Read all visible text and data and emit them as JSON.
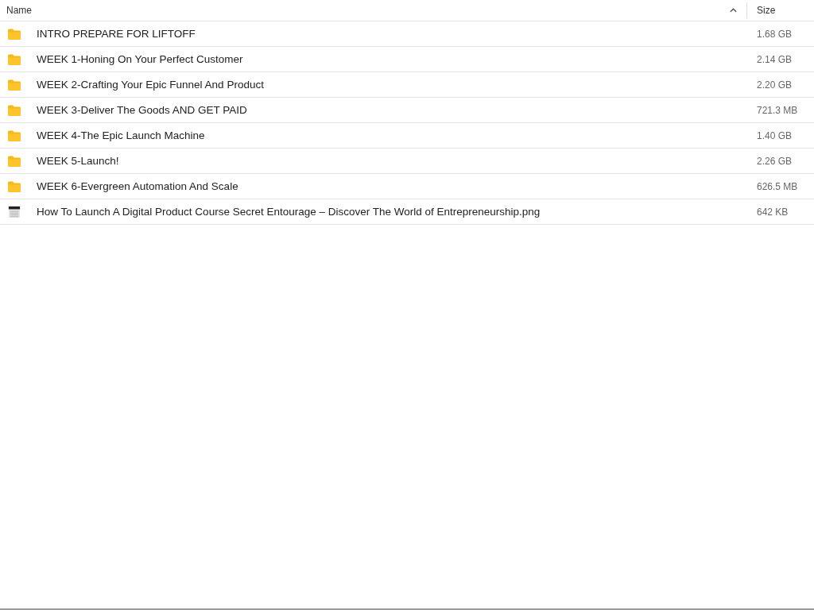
{
  "columns": [
    {
      "label": "Name",
      "sorted": true
    },
    {
      "label": "Size",
      "sorted": false
    }
  ],
  "rows": [
    {
      "kind": "folder",
      "name": "INTRO PREPARE FOR LIFTOFF",
      "size": "1.68 GB"
    },
    {
      "kind": "folder",
      "name": "WEEK 1-Honing On Your Perfect Customer",
      "size": "2.14 GB"
    },
    {
      "kind": "folder",
      "name": "WEEK 2-Crafting Your Epic Funnel And Product",
      "size": "2.20 GB"
    },
    {
      "kind": "folder",
      "name": "WEEK 3-Deliver The Goods AND GET PAID",
      "size": "721.3 MB"
    },
    {
      "kind": "folder",
      "name": "WEEK 4-The Epic Launch Machine",
      "size": "1.40 GB"
    },
    {
      "kind": "folder",
      "name": "WEEK 5-Launch!",
      "size": "2.26 GB"
    },
    {
      "kind": "folder",
      "name": "WEEK 6-Evergreen Automation And Scale",
      "size": "626.5 MB"
    },
    {
      "kind": "image",
      "name": "How To Launch A Digital Product Course Secret Entourage – Discover The World of Entrepreneurship.png",
      "size": "642 KB"
    }
  ]
}
